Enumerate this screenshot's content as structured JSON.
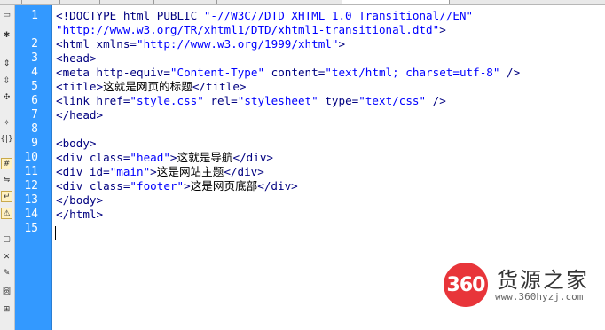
{
  "editor": {
    "line_numbers": [
      "1",
      "2",
      "3",
      "4",
      "5",
      "6",
      "7",
      "8",
      "9",
      "10",
      "11",
      "12",
      "13",
      "14",
      "15"
    ],
    "lines": [
      {
        "tag1": "<!DOCTYPE html PUBLIC ",
        "val1": "\"-//W3C//DTD XHTML 1.0 Transitional//EN\""
      },
      {
        "val1": "\"http://www.w3.org/TR/xhtml1/DTD/xhtml1-transitional.dtd\"",
        "tag1": ">"
      },
      {
        "tag1": "<html ",
        "attr1": "xmlns=",
        "val1": "\"http://www.w3.org/1999/xhtml\"",
        "tag2": ">"
      },
      {
        "tag1": "<head>"
      },
      {
        "tag1": "<meta ",
        "attr1": "http-equiv=",
        "val1": "\"Content-Type\"",
        "attr2": " content=",
        "val2": "\"text/html; charset=utf-8\"",
        "tag2": " />"
      },
      {
        "tag1": "<title>",
        "text": "这就是网页的标题",
        "tag2": "</title>"
      },
      {
        "tag1": "<link ",
        "attr1": "href=",
        "val1": "\"style.css\"",
        "attr2": " rel=",
        "val2": "\"stylesheet\"",
        "attr3": " type=",
        "val3": "\"text/css\"",
        "tag2": " />"
      },
      {
        "tag1": "</head>"
      },
      {
        "tag1": "<body>"
      },
      {
        "tag1": "<div ",
        "attr1": "class=",
        "val1": "\"head\"",
        "tag2": ">",
        "text": "这就是导航",
        "tag3": "</div>"
      },
      {
        "tag1": "<div ",
        "attr1": "id=",
        "val1": "\"main\"",
        "tag2": ">",
        "text": "这是网站主题",
        "tag3": "</div>"
      },
      {
        "tag1": "<div ",
        "attr1": "class=",
        "val1": "\"footer\"",
        "tag2": ">",
        "text": "这是网页底部",
        "tag3": "</div>"
      },
      {
        "tag1": "</body>"
      },
      {
        "tag1": "</html>"
      }
    ]
  },
  "watermark": {
    "badge": "360",
    "name": "货源之家",
    "url": "www.360hyzj.com"
  },
  "colors": {
    "gutter": "#3399ff",
    "tag": "#000080",
    "value": "#0000ff",
    "badge": "#e8353a"
  }
}
